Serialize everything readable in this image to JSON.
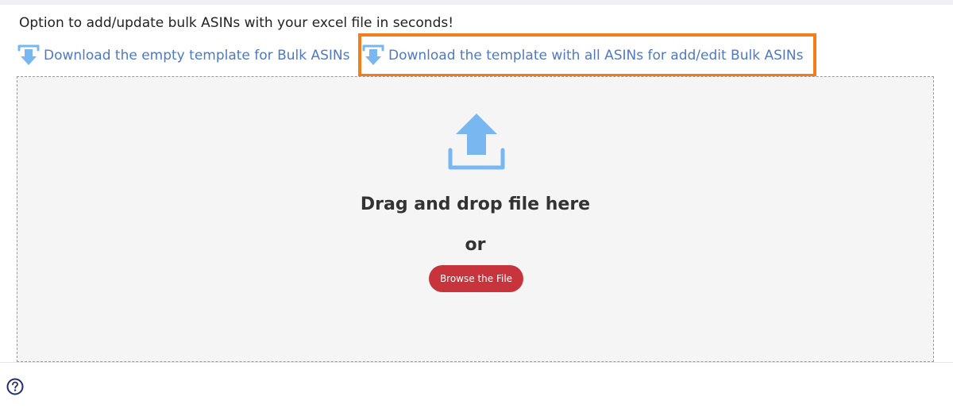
{
  "header": {
    "intro_text": "Option to add/update bulk ASINs with your excel file in seconds!"
  },
  "downloads": {
    "empty_template": {
      "label": "Download the empty template for Bulk ASINs",
      "icon": "download-icon"
    },
    "all_asins_template": {
      "label": "Download the template with all ASINs for add/edit Bulk ASINs",
      "icon": "download-icon"
    }
  },
  "upload": {
    "icon": "upload-icon",
    "title": "Drag and drop file here",
    "or_text": "or",
    "browse_label": "Browse the File"
  },
  "footer": {
    "help_icon": "help-icon"
  },
  "colors": {
    "link": "#4f79c4",
    "highlight": "#f37d1a",
    "browse_button": "#c8343b",
    "upload_icon": "#78b7f0",
    "help_icon": "#1f2f6e"
  }
}
